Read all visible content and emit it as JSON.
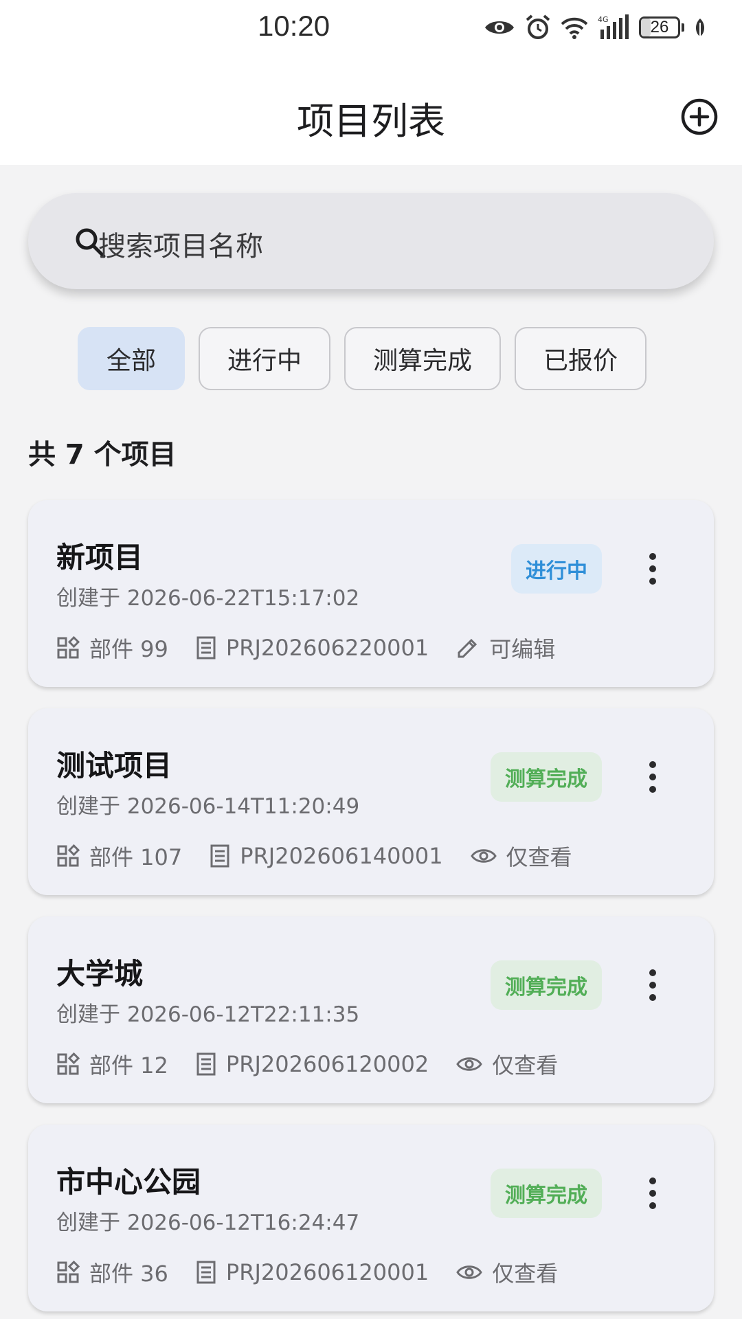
{
  "status_bar": {
    "time": "10:20",
    "battery_level": "26",
    "battery_fraction": 0.26,
    "icons": [
      "eye-icon",
      "alarm-icon",
      "wifi-icon",
      "signal-4g-icon",
      "battery-icon",
      "leaf-icon"
    ]
  },
  "header": {
    "title": "项目列表",
    "add_icon": "add-circle-icon"
  },
  "search": {
    "placeholder": "搜索项目名称",
    "icon": "search-icon"
  },
  "filters": [
    {
      "label": "全部",
      "selected": true
    },
    {
      "label": "进行中",
      "selected": false
    },
    {
      "label": "测算完成",
      "selected": false
    },
    {
      "label": "已报价",
      "selected": false
    }
  ],
  "summary": {
    "count_text": "共 7 个项目"
  },
  "colors": {
    "accent_selected_chip": "#d7e3f5",
    "status_progress_text": "#2f8fd8",
    "status_progress_bg": "#dceaf8",
    "status_done_text": "#52ae57",
    "status_done_bg": "#e1eee2",
    "card_bg": "#eff0f6",
    "page_bg": "#f3f3f4"
  },
  "projects": [
    {
      "name": "新项目",
      "created": "创建于 2026-06-22T15:17:02",
      "status": "进行中",
      "parts": "部件 99",
      "code": "PRJ202606220001",
      "permission": "可编辑",
      "permission_icon": "pencil-icon"
    },
    {
      "name": "测试项目",
      "created": "创建于 2026-06-14T11:20:49",
      "status": "测算完成",
      "parts": "部件 107",
      "code": "PRJ202606140001",
      "permission": "仅查看",
      "permission_icon": "eye-icon"
    },
    {
      "name": "大学城",
      "created": "创建于 2026-06-12T22:11:35",
      "status": "测算完成",
      "parts": "部件 12",
      "code": "PRJ202606120002",
      "permission": "仅查看",
      "permission_icon": "eye-icon"
    },
    {
      "name": "市中心公园",
      "created": "创建于 2026-06-12T16:24:47",
      "status": "测算完成",
      "parts": "部件 36",
      "code": "PRJ202606120001",
      "permission": "仅查看",
      "permission_icon": "eye-icon"
    }
  ]
}
